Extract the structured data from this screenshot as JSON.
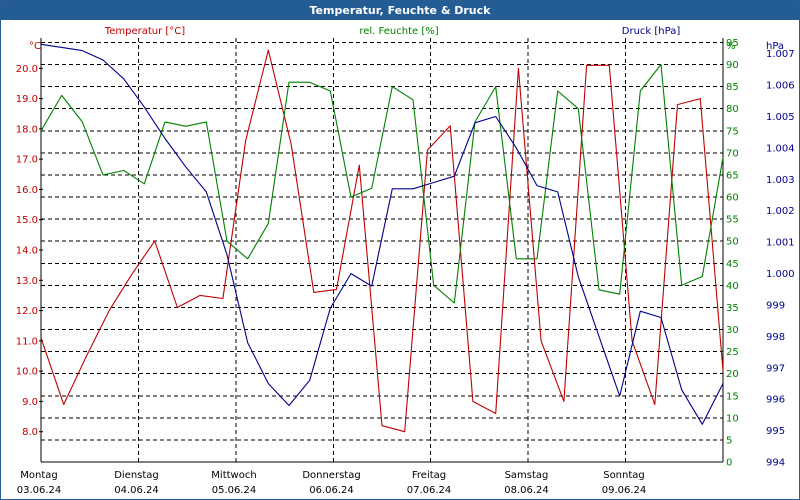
{
  "title": "Temperatur, Feuchte & Druck",
  "colors": {
    "title_bg": "#245d96",
    "temperature": "#c00000",
    "humidity": "#008000",
    "pressure": "#00008b",
    "grid": "#000000"
  },
  "chart_data": {
    "type": "line",
    "title": "Temperatur, Feuchte & Druck",
    "x_start": "03.06.24 00:00",
    "x_end": "09.06.24 24:00",
    "grid": true,
    "axes": {
      "left": {
        "unit": "°C",
        "label": "Temperatur [°C]",
        "range": [
          7.0,
          21.0
        ],
        "ticks": [
          "8.0",
          "9.0",
          "10.0",
          "11.0",
          "12.0",
          "13.0",
          "14.0",
          "15.0",
          "16.0",
          "17.0",
          "18.0",
          "19.0",
          "20.0"
        ]
      },
      "right1": {
        "unit": "%",
        "label": "rel. Feuchte [%]",
        "range": [
          0,
          96
        ],
        "ticks": [
          "0",
          "5",
          "10",
          "15",
          "20",
          "25",
          "30",
          "35",
          "40",
          "45",
          "50",
          "55",
          "60",
          "65",
          "70",
          "75",
          "80",
          "85",
          "90",
          "95"
        ]
      },
      "right2": {
        "unit": "hPa",
        "label": "Druck [hPa]",
        "range": [
          994,
          1007.5
        ],
        "ticks": [
          "994",
          "995",
          "996",
          "997",
          "998",
          "999",
          "1.000",
          "1.001",
          "1.002",
          "1.003",
          "1.004",
          "1.005",
          "1.006",
          "1.007"
        ]
      }
    },
    "x_ticks": [
      {
        "day": "Montag",
        "date": "03.06.24"
      },
      {
        "day": "Dienstag",
        "date": "04.06.24"
      },
      {
        "day": "Mittwoch",
        "date": "05.06.24"
      },
      {
        "day": "Donnerstag",
        "date": "06.06.24"
      },
      {
        "day": "Freitag",
        "date": "07.06.24"
      },
      {
        "day": "Samstag",
        "date": "08.06.24"
      },
      {
        "day": "Sonntag",
        "date": "09.06.24"
      }
    ],
    "x_hours": [
      0,
      6,
      12,
      18,
      24,
      30,
      36,
      42,
      48,
      54,
      60,
      66,
      72,
      78,
      84,
      90,
      96,
      102,
      108,
      114,
      120,
      126,
      132,
      138,
      144,
      150,
      156,
      162,
      168
    ],
    "series": [
      {
        "name": "Temperatur [°C]",
        "axis": "left",
        "values": [
          11.1,
          8.9,
          10.5,
          12.0,
          13.2,
          14.3,
          12.1,
          12.5,
          12.4,
          17.6,
          20.6,
          17.5,
          12.6,
          12.7,
          16.8,
          8.2,
          8.0,
          17.3,
          18.1,
          9.0,
          8.6,
          20.0,
          11.0,
          9.0,
          20.1,
          20.1,
          11.0,
          8.9,
          18.8,
          19.0,
          10.0
        ]
      },
      {
        "name": "rel. Feuchte [%]",
        "axis": "right1",
        "values": [
          75,
          83,
          77,
          65,
          66,
          63,
          77,
          76,
          77,
          50,
          46,
          54,
          86,
          86,
          84,
          60,
          62,
          85,
          82,
          40,
          36,
          77,
          85,
          46,
          46,
          84,
          80,
          39,
          38,
          84,
          90,
          40,
          42,
          69
        ]
      },
      {
        "name": "Druck [hPa]",
        "axis": "right2",
        "values": [
          1007.3,
          1007.2,
          1007.1,
          1006.8,
          1006.2,
          1005.3,
          1004.3,
          1003.4,
          1002.6,
          1000.6,
          997.8,
          996.5,
          995.8,
          996.6,
          998.9,
          1000.0,
          999.6,
          1002.7,
          1002.7,
          1002.9,
          1003.1,
          1004.8,
          1005.0,
          1004.0,
          1002.8,
          1002.6,
          999.9,
          998.0,
          996.1,
          998.8,
          998.6,
          996.3,
          995.2,
          996.5
        ]
      }
    ]
  }
}
